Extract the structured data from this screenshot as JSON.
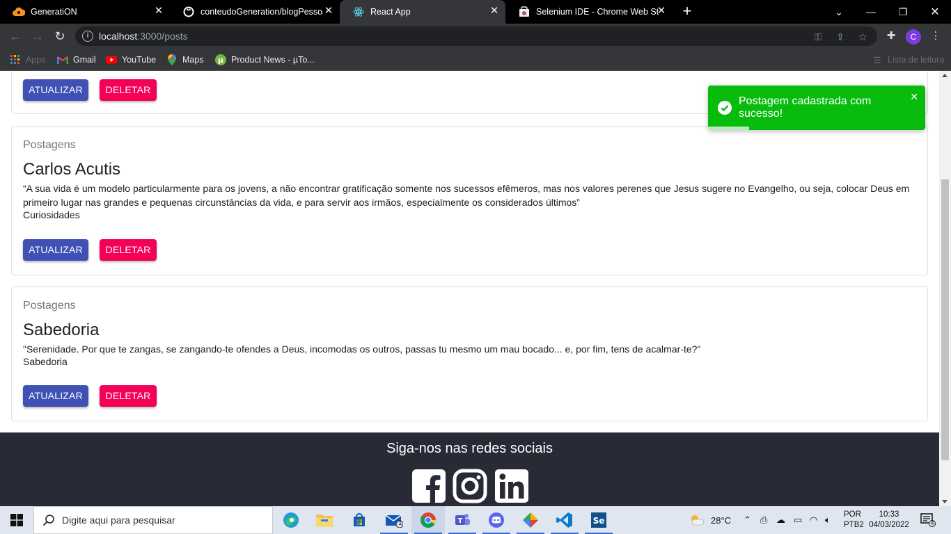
{
  "browser": {
    "tabs": [
      {
        "title": "GeneratiON",
        "icon": "cloud-icon",
        "active": false
      },
      {
        "title": "conteudoGeneration/blogPessoal",
        "icon": "github-icon",
        "active": false
      },
      {
        "title": "React App",
        "icon": "react-icon",
        "active": true
      },
      {
        "title": "Selenium IDE - Chrome Web Store",
        "icon": "webstore-icon",
        "active": false
      }
    ],
    "url_host": "localhost",
    "url_path": ":3000/posts",
    "profile_initial": "C",
    "bookmarks": [
      {
        "label": "Apps",
        "icon": "apps-grid-icon"
      },
      {
        "label": "Gmail",
        "icon": "gmail-icon"
      },
      {
        "label": "YouTube",
        "icon": "youtube-icon"
      },
      {
        "label": "Maps",
        "icon": "maps-icon"
      },
      {
        "label": "Product News - µTo...",
        "icon": "utorrent-icon"
      }
    ],
    "reading_list": "Lista de leitura"
  },
  "page": {
    "button_update": "ATUALIZAR",
    "button_delete": "DELETAR",
    "posts": [
      {
        "kicker": "Postagens",
        "title": "Carlos Acutis",
        "text": "“A sua vida é um modelo particularmente para os jovens, a não encontrar gratificação somente nos sucessos efêmeros, mas nos valores perenes que Jesus sugere no Evangelho, ou seja, colocar Deus em primeiro lugar nas grandes e pequenas circunstâncias da vida, e para servir aos irmãos, especialmente os considerados últimos”",
        "theme": "Curiosidades"
      },
      {
        "kicker": "Postagens",
        "title": "Sabedoria",
        "text": "\"Serenidade. Por que te zangas, se zangando-te ofendes a Deus, incomodas os outros, passas tu mesmo um mau bocado... e, por fim, tens de acalmar-te?\"",
        "theme": "Sabedoria"
      }
    ],
    "toast": {
      "message": "Postagem cadastrada com sucesso!",
      "color": "#07bc0c",
      "progress": 0.19
    },
    "footer": {
      "title": "Siga-nos nas redes sociais",
      "socials": [
        "facebook-icon",
        "instagram-icon",
        "linkedin-icon"
      ]
    }
  },
  "taskbar": {
    "search_placeholder": "Digite aqui para pesquisar",
    "weather": "28°C",
    "language": "POR",
    "layout": "PTB2",
    "time": "10:33",
    "date": "04/03/2022",
    "notification_count": "4",
    "mail_badge": "1"
  }
}
